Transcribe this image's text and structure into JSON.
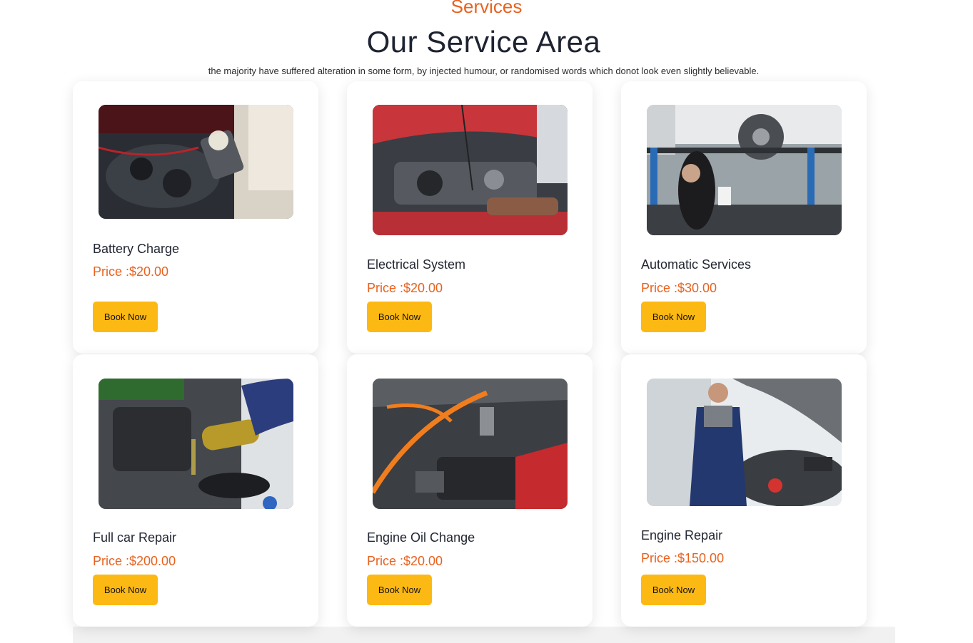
{
  "section": {
    "eyebrow": "Services",
    "heading": "Our Service Area",
    "subtitle": "the majority have suffered alteration in some form, by injected humour, or randomised words which donot look even slightly believable."
  },
  "services": [
    {
      "title": "Battery Charge",
      "price": "Price :$20.00",
      "button": "Book Now",
      "image": "battery-charge-photo"
    },
    {
      "title": "Electrical System",
      "price": "Price :$20.00",
      "button": "Book Now",
      "image": "electrical-system-photo"
    },
    {
      "title": "Automatic Services",
      "price": "Price :$30.00",
      "button": "Book Now",
      "image": "automatic-services-photo"
    },
    {
      "title": "Full car Repair",
      "price": "Price :$200.00",
      "button": "Book Now",
      "image": "full-car-repair-photo"
    },
    {
      "title": "Engine Oil Change",
      "price": "Price :$20.00",
      "button": "Book Now",
      "image": "engine-oil-change-photo"
    },
    {
      "title": "Engine Repair",
      "price": "Price :$150.00",
      "button": "Book Now",
      "image": "engine-repair-photo"
    }
  ],
  "colors": {
    "accent": "#e8621f",
    "button": "#fdb913",
    "heading": "#1e2332"
  }
}
